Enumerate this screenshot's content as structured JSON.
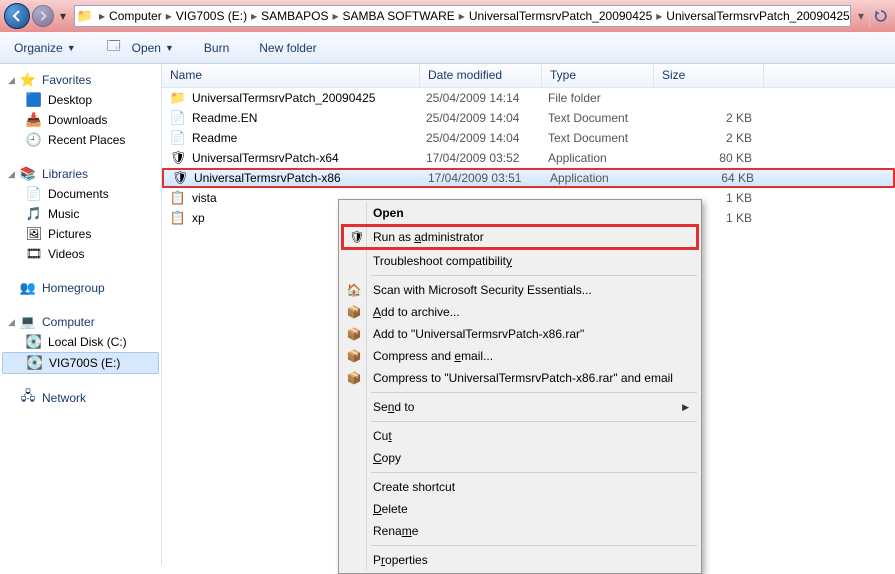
{
  "breadcrumbs": [
    "Computer",
    "VIG700S (E:)",
    "SAMBAPOS",
    "SAMBA SOFTWARE",
    "UniversalTermsrvPatch_20090425",
    "UniversalTermsrvPatch_20090425"
  ],
  "toolbar": {
    "organize": "Organize",
    "open": "Open",
    "burn": "Burn",
    "newfolder": "New folder"
  },
  "sidebar": {
    "favorites": {
      "label": "Favorites",
      "items": [
        "Desktop",
        "Downloads",
        "Recent Places"
      ]
    },
    "libraries": {
      "label": "Libraries",
      "items": [
        "Documents",
        "Music",
        "Pictures",
        "Videos"
      ]
    },
    "homegroup": {
      "label": "Homegroup"
    },
    "computer": {
      "label": "Computer",
      "items": [
        "Local Disk (C:)",
        "VIG700S (E:)"
      ]
    },
    "network": {
      "label": "Network"
    }
  },
  "columns": {
    "name": "Name",
    "date": "Date modified",
    "type": "Type",
    "size": "Size"
  },
  "files": [
    {
      "name": "UniversalTermsrvPatch_20090425",
      "date": "25/04/2009 14:14",
      "type": "File folder",
      "size": "",
      "icon": "folder"
    },
    {
      "name": "Readme.EN",
      "date": "25/04/2009 14:04",
      "type": "Text Document",
      "size": "2 KB",
      "icon": "text"
    },
    {
      "name": "Readme",
      "date": "25/04/2009 14:04",
      "type": "Text Document",
      "size": "2 KB",
      "icon": "text"
    },
    {
      "name": "UniversalTermsrvPatch-x64",
      "date": "17/04/2009 03:52",
      "type": "Application",
      "size": "80 KB",
      "icon": "app"
    },
    {
      "name": "UniversalTermsrvPatch-x86",
      "date": "17/04/2009 03:51",
      "type": "Application",
      "size": "64 KB",
      "icon": "app"
    },
    {
      "name": "vista",
      "date": "",
      "type": "",
      "size": "1 KB",
      "icon": "reg"
    },
    {
      "name": "xp",
      "date": "",
      "type": "",
      "size": "1 KB",
      "icon": "reg"
    }
  ],
  "contextmenu": {
    "open": "Open",
    "runas_pre": "Run as ",
    "runas_u": "a",
    "runas_post": "dministrator",
    "troubleshoot_pre": "Troubleshoot compatibilit",
    "troubleshoot_u": "y",
    "scan": "Scan with Microsoft Security Essentials...",
    "addarchive_u": "A",
    "addarchive_post": "dd to archive...",
    "addto": "Add to \"UniversalTermsrvPatch-x86.rar\"",
    "compressemail_pre": "Compress and ",
    "compressemail_u": "e",
    "compressemail_post": "mail...",
    "compressto": "Compress to \"UniversalTermsrvPatch-x86.rar\" and email",
    "sendto_pre": "Se",
    "sendto_u": "n",
    "sendto_post": "d to",
    "cut_pre": "Cu",
    "cut_u": "t",
    "copy_u": "C",
    "copy_post": "opy",
    "shortcut": "Create shortcut",
    "delete_u": "D",
    "delete_post": "elete",
    "rename_pre": "Rena",
    "rename_u": "m",
    "rename_post": "e",
    "properties_pre": "P",
    "properties_u": "r",
    "properties_post": "operties"
  }
}
